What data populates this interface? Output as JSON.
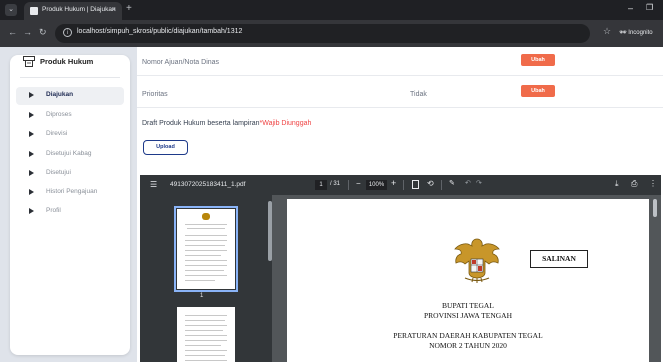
{
  "browser": {
    "menu_icon": "chevron-down",
    "tab_title": "Produk Hukum | Diajukan",
    "tab_close": "×",
    "new_tab": "+",
    "url": "localhost/simpuh_skrosi/public/diajukan/tambah/1312",
    "incognito_label": "Incognito"
  },
  "sidebar": {
    "brand": "Produk Hukum",
    "items": [
      {
        "label": "Diajukan",
        "active": true
      },
      {
        "label": "Diproses",
        "active": false
      },
      {
        "label": "Direvisi",
        "active": false
      },
      {
        "label": "Disetujui Kabag",
        "active": false
      },
      {
        "label": "Disetujui",
        "active": false
      },
      {
        "label": "Histori Pengajuan",
        "active": false
      },
      {
        "label": "Profil",
        "active": false
      }
    ]
  },
  "form": {
    "nomor_label": "Nomor Ajuan/Nota Dinas",
    "prioritas_label": "Prioritas",
    "prioritas_value": "Tidak",
    "ubah_label": "Ubah",
    "draft_label": "Draft Produk Hukum beserta lampiran",
    "draft_required": "*Wajib Diunggah",
    "upload_label": "Upload",
    "accent_color": "#f06b4a",
    "upload_color": "#1e3a8a"
  },
  "pdf": {
    "filename": "4913072025183411_1.pdf",
    "current_page": "1",
    "total_pages": "/ 31",
    "zoom": "100%",
    "thumbnail_page": "1",
    "document": {
      "stamp": "SALINAN",
      "line1": "BUPATI TEGAL",
      "line2": "PROVINSI JAWA TENGAH",
      "line3": "PERATURAN DAERAH KABUPATEN TEGAL",
      "line4": "NOMOR   2   TAHUN 2020"
    }
  }
}
